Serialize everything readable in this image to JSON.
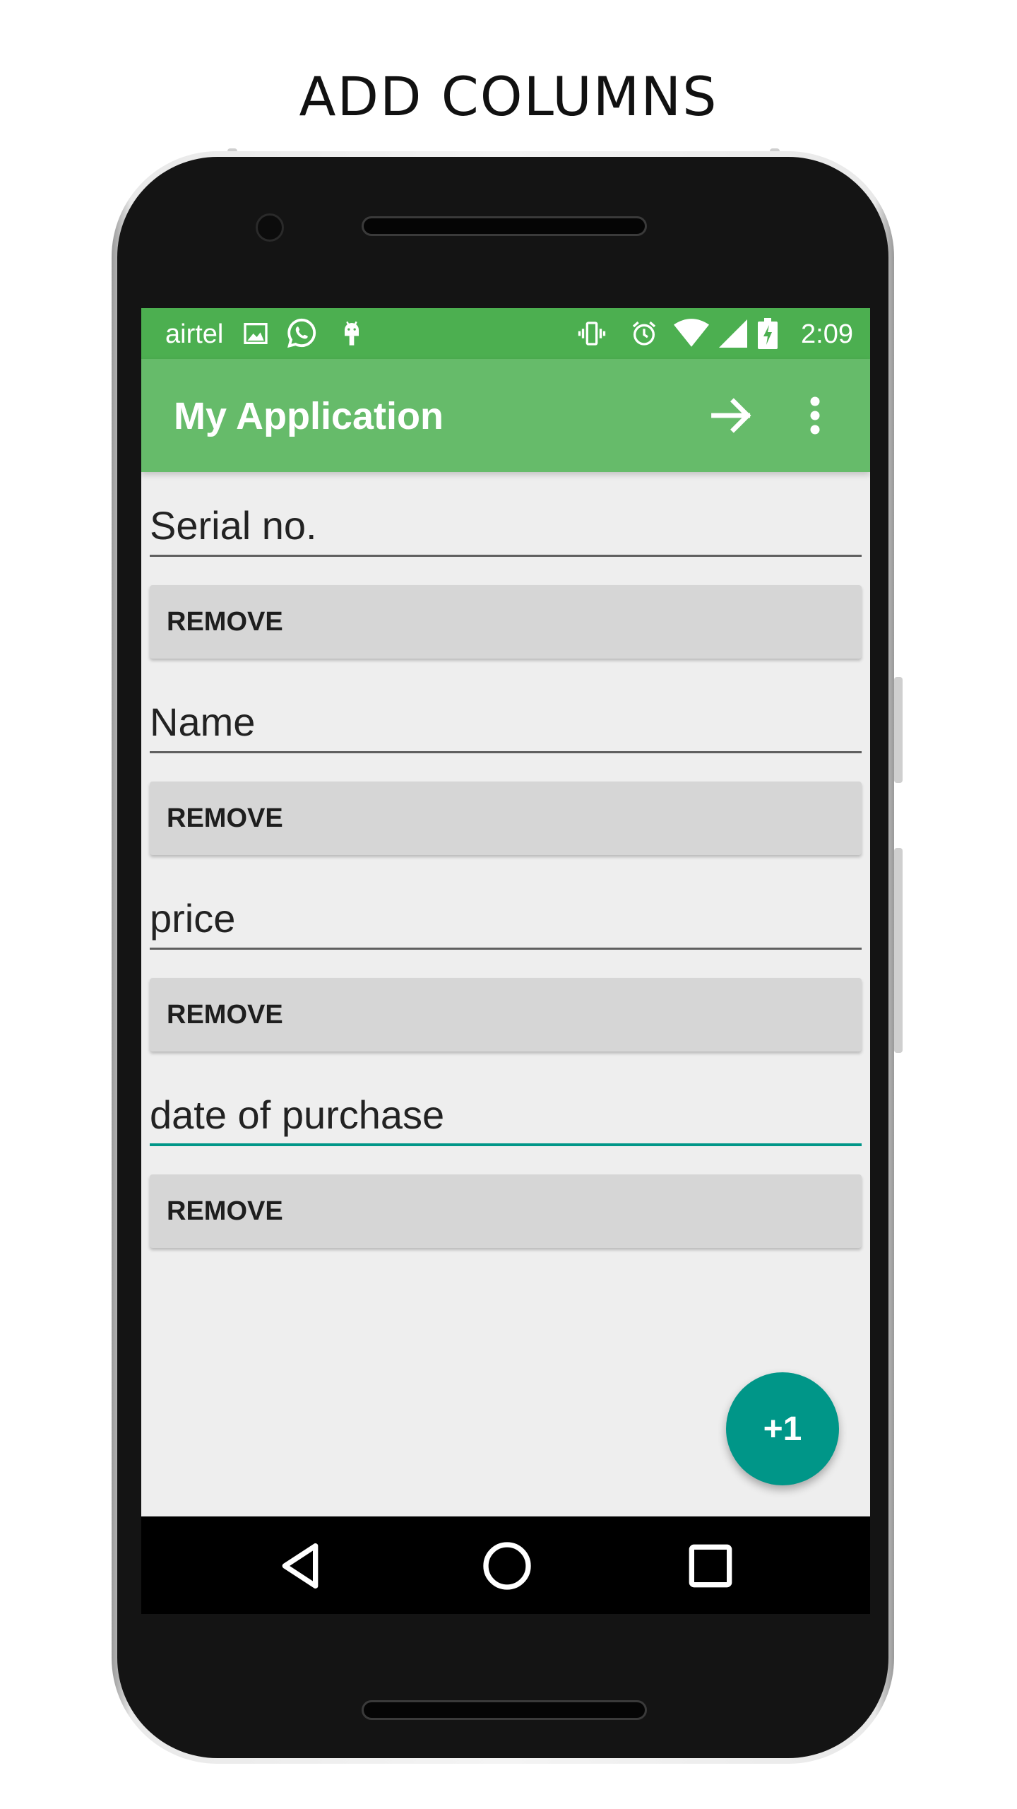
{
  "heading": "ADD COLUMNS",
  "status_bar": {
    "carrier": "airtel",
    "time": "2:09",
    "left_icons": [
      "image-notification-icon",
      "whatsapp-icon",
      "android-debug-icon"
    ],
    "right_icons": [
      "vibrate-icon",
      "alarm-icon",
      "wifi-icon",
      "signal-icon",
      "battery-charging-icon"
    ]
  },
  "app_bar": {
    "title": "My Application",
    "actions": [
      "arrow-forward-icon",
      "overflow-menu-icon"
    ]
  },
  "columns": [
    {
      "value": "Serial no.",
      "button_label": "REMOVE"
    },
    {
      "value": "Name",
      "button_label": "REMOVE"
    },
    {
      "value": "price",
      "button_label": "REMOVE"
    },
    {
      "value": "date of purchase",
      "button_label": "REMOVE"
    }
  ],
  "fab_label": "+1",
  "nav": [
    "back-icon",
    "home-icon",
    "recents-icon"
  ],
  "colors": {
    "status_bar": "#4caf50",
    "app_bar": "#66bb6a",
    "accent": "#009688",
    "background": "#eeeeee",
    "button": "#d6d6d6"
  }
}
